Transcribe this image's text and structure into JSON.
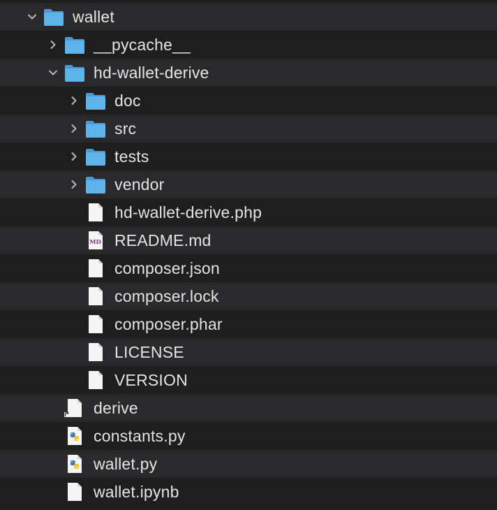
{
  "items": [
    {
      "label": "wallet",
      "depth": 0,
      "kind": "folder",
      "expanded": true
    },
    {
      "label": "__pycache__",
      "depth": 1,
      "kind": "folder",
      "expanded": false
    },
    {
      "label": "hd-wallet-derive",
      "depth": 1,
      "kind": "folder",
      "expanded": true
    },
    {
      "label": "doc",
      "depth": 2,
      "kind": "folder",
      "expanded": false
    },
    {
      "label": "src",
      "depth": 2,
      "kind": "folder",
      "expanded": false
    },
    {
      "label": "tests",
      "depth": 2,
      "kind": "folder",
      "expanded": false
    },
    {
      "label": "vendor",
      "depth": 2,
      "kind": "folder",
      "expanded": false
    },
    {
      "label": "hd-wallet-derive.php",
      "depth": 2,
      "kind": "file"
    },
    {
      "label": "README.md",
      "depth": 2,
      "kind": "markdown",
      "badge": "MD"
    },
    {
      "label": "composer.json",
      "depth": 2,
      "kind": "file"
    },
    {
      "label": "composer.lock",
      "depth": 2,
      "kind": "file"
    },
    {
      "label": "composer.phar",
      "depth": 2,
      "kind": "file"
    },
    {
      "label": "LICENSE",
      "depth": 2,
      "kind": "file"
    },
    {
      "label": "VERSION",
      "depth": 2,
      "kind": "file"
    },
    {
      "label": "derive",
      "depth": 1,
      "kind": "alias"
    },
    {
      "label": "constants.py",
      "depth": 1,
      "kind": "python"
    },
    {
      "label": "wallet.py",
      "depth": 1,
      "kind": "python"
    },
    {
      "label": "wallet.ipynb",
      "depth": 1,
      "kind": "file"
    }
  ],
  "colors": {
    "background": "#1e1e1e",
    "row_alt": "#2a2a2c",
    "folder": "#5eb3ea",
    "folder_tab": "#4a9ad6",
    "text": "#e4e4e4",
    "chevron": "#b8b8b8"
  }
}
